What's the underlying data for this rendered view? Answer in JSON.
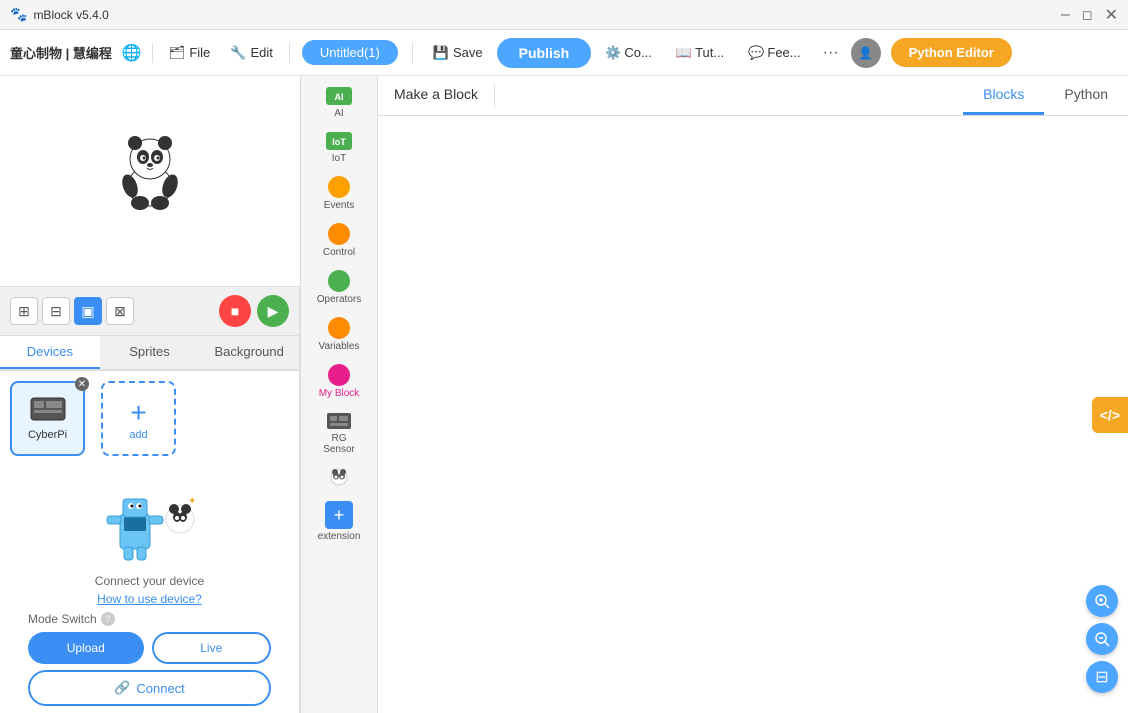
{
  "titlebar": {
    "title": "mBlock v5.4.0",
    "app_icon": "🐼"
  },
  "menubar": {
    "brand": "童心制物 | 慧编程",
    "globe_icon": "🌐",
    "file_label": "File",
    "edit_label": "Edit",
    "project_name": "Untitled(1)",
    "save_label": "Save",
    "publish_label": "Publish",
    "connect_label": "Co...",
    "tutorial_label": "Tut...",
    "feedback_label": "Fee...",
    "more_label": "···",
    "python_editor_label": "Python Editor"
  },
  "stage": {
    "panda_emoji": "🐼"
  },
  "stage_controls": {
    "stop_icon": "■",
    "run_icon": "▶"
  },
  "tabs": {
    "devices_label": "Devices",
    "sprites_label": "Sprites",
    "background_label": "Background"
  },
  "devices": {
    "device_name": "CyberPi",
    "device_icon": "📟",
    "add_label": "add"
  },
  "device_connect": {
    "connect_text": "Connect your device",
    "how_to_link": "How to use device?",
    "mode_switch_label": "Mode Switch",
    "upload_label": "Upload",
    "live_label": "Live",
    "connect_label": "Connect",
    "link_icon": "🔗"
  },
  "categories": [
    {
      "id": "ai",
      "icon": "ai-icon",
      "label": "AI",
      "color": "#4CAF50",
      "type": "img"
    },
    {
      "id": "iot",
      "icon": "iot-icon",
      "label": "IoT",
      "color": "#4CAF50",
      "type": "img"
    },
    {
      "id": "events",
      "icon": "events-icon",
      "label": "Events",
      "color": "#FFA000",
      "type": "dot"
    },
    {
      "id": "control",
      "icon": "control-icon",
      "label": "Control",
      "color": "#FF8C00",
      "type": "dot"
    },
    {
      "id": "operators",
      "icon": "operators-icon",
      "label": "Operators",
      "color": "#4CAF50",
      "type": "dot"
    },
    {
      "id": "variables",
      "icon": "variables-icon",
      "label": "Variables",
      "color": "#FF8C00",
      "type": "dot"
    },
    {
      "id": "myblock",
      "icon": "myblock-icon",
      "label": "My Block",
      "color": "#E91E8C",
      "type": "dot",
      "active": true
    },
    {
      "id": "rgsensor",
      "icon": "rgsensor-icon",
      "label": "RG\nSensor",
      "color": "#4CAF50",
      "type": "img"
    },
    {
      "id": "sprite2",
      "icon": "sprite2-icon",
      "label": "",
      "color": "#4CAF50",
      "type": "img"
    },
    {
      "id": "extension",
      "icon": "extension-icon",
      "label": "extension",
      "color": "#3b8ef3",
      "type": "plus"
    }
  ],
  "make_block": {
    "tab_label": "Make a Block"
  },
  "coding_tabs": {
    "blocks_label": "Blocks",
    "python_label": "Python"
  },
  "code_toggle": {
    "icon": "</>"
  },
  "zoom": {
    "zoom_in_icon": "🔍",
    "zoom_out_icon": "🔍",
    "reset_icon": "⊟"
  }
}
